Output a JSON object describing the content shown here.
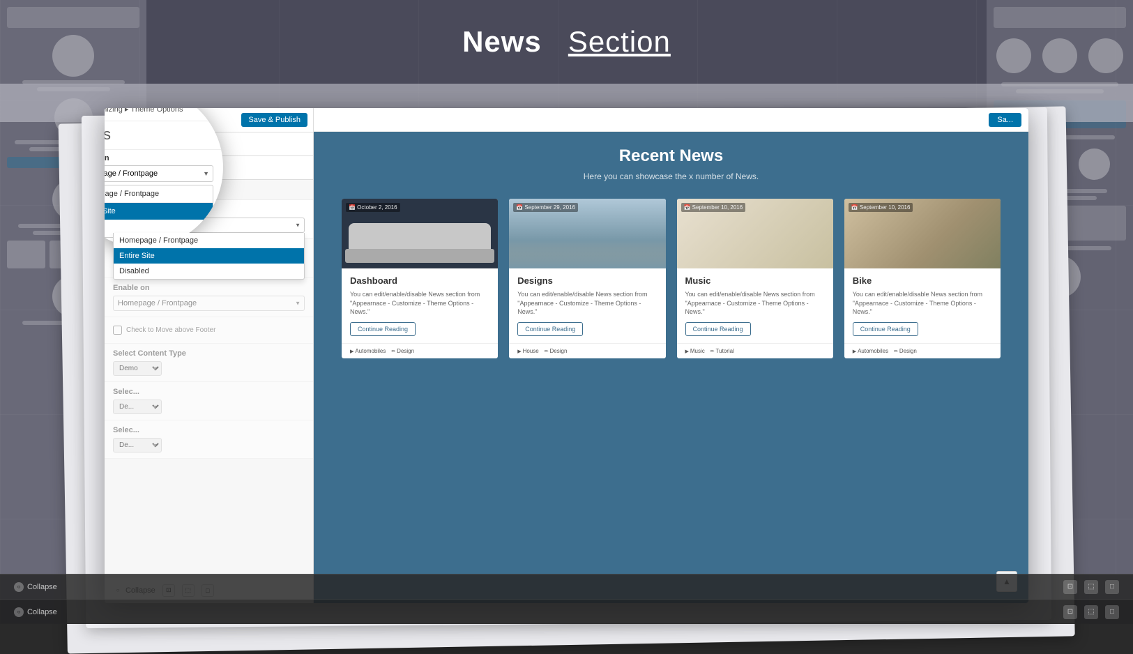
{
  "page": {
    "title": "News Section",
    "title_bold": "News",
    "title_regular": "Section"
  },
  "header": {
    "title_bold": "News",
    "title_underline": "Section"
  },
  "customizer": {
    "save_publish": "Save & Publish",
    "close_label": "×",
    "back_label": "‹",
    "breadcrumb": "Customizing ▸ Theme Options",
    "section_name": "News",
    "enable_on_label": "Enable on",
    "dropdown_value": "Homepage / Frontpage",
    "dropdown_options": [
      "Homepage / Frontpage",
      "Entire Site",
      "Disabled"
    ],
    "checkbox_label": "Check to Move above Footer",
    "content_type_label": "Select Content Type",
    "content_type_value": "Demo",
    "select_demo_label": "Selec...",
    "select_demo_value": "De...",
    "collapse_label": "Collapse"
  },
  "circle_popup": {
    "back_label": "‹",
    "breadcrumb": "Customizing ▸ Theme Options",
    "title": "News",
    "enable_on_label": "Enable on",
    "select_value": "Homepage / Frontpage",
    "select_arrow": "▼",
    "dropdown_options": [
      {
        "label": "Homepage / Frontpage",
        "active": false
      },
      {
        "label": "Entire Site",
        "active": true
      },
      {
        "label": "d...",
        "active": false
      }
    ]
  },
  "preview": {
    "save_button": "Sa...",
    "recent_news_heading": "Recent News",
    "recent_news_subheading": "Here you can showcase the x number of News.",
    "cards": [
      {
        "date": "October 2, 2016",
        "title": "Dashboard",
        "text": "You can edit/enable/disable News section from \"Appearnace - Customize - Theme Options - News.\"",
        "button": "Continue Reading",
        "tags": [
          "Automobiles",
          "Design"
        ],
        "tag_types": [
          "arrow",
          "pencil"
        ]
      },
      {
        "date": "September 29, 2016",
        "title": "Designs",
        "text": "You can edit/enable/disable News section from \"Appearnace - Customize - Theme Options - News.\"",
        "button": "Continue Reading",
        "tags": [
          "House",
          "Design"
        ],
        "tag_types": [
          "arrow",
          "pencil"
        ]
      },
      {
        "date": "September 10, 2016",
        "title": "Music",
        "text": "You can edit/enable/disable News section from \"Appearnace - Customize - Theme Options - News.\"",
        "button": "Continue Reading",
        "tags": [
          "Music",
          "Tutorial"
        ],
        "tag_types": [
          "arrow",
          "pencil"
        ]
      },
      {
        "date": "September 10, 2016",
        "title": "Bike",
        "text": "You can edit/enable/disable News section from \"Appearnace - Customize - Theme Options - News.\"",
        "button": "Continue Reading",
        "tags": [
          "Automobiles",
          "Design"
        ],
        "tag_types": [
          "arrow",
          "pencil"
        ]
      }
    ],
    "scroll_up": "▲"
  },
  "toolbar_rows": [
    {
      "label": "Collapse",
      "icons": [
        "⊡",
        "⬚",
        "□"
      ]
    },
    {
      "label": "Collapse",
      "icons": [
        "⊡",
        "⬚",
        "□"
      ]
    },
    {
      "label": "Collapse",
      "icons": [
        "⊡",
        "⬚",
        "□"
      ]
    }
  ]
}
